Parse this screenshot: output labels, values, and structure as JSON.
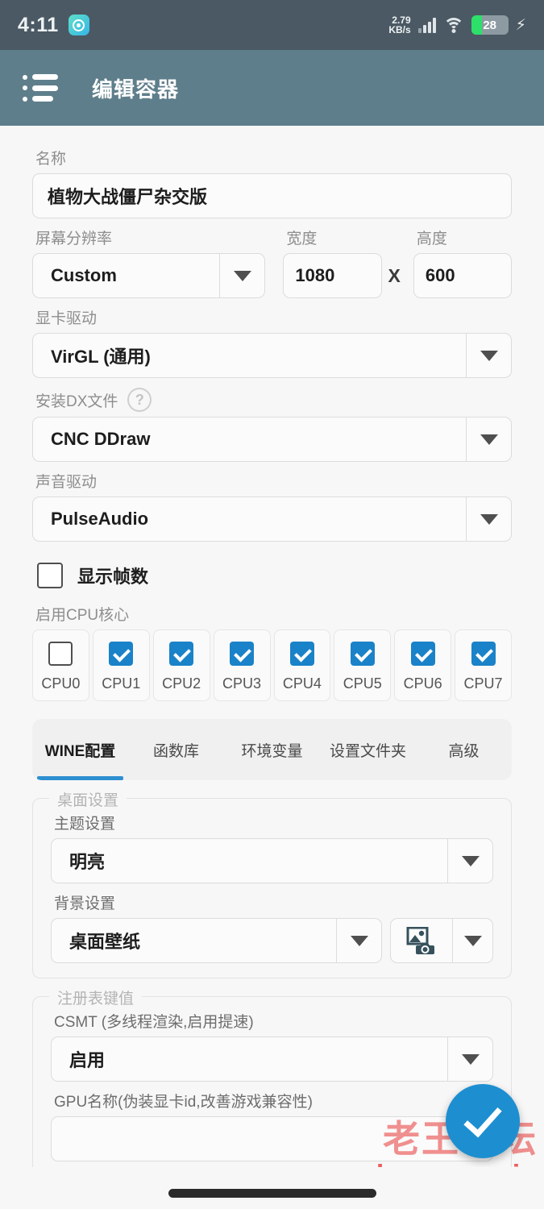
{
  "statusbar": {
    "clock": "4:11",
    "app_icon": "eye-app-icon",
    "network_speed_value": "2.79",
    "network_speed_unit": "KB/s",
    "signal_icon": "cellular-signal-icon",
    "wifi_icon": "wifi-icon",
    "battery_percent": "28",
    "battery_fill_color": "#2ce06a",
    "charging_icon": "charging-bolt-icon"
  },
  "appbar": {
    "menu_icon": "list-menu-icon",
    "title": "编辑容器",
    "background_color": "#5e7e8b"
  },
  "form": {
    "name_label": "名称",
    "name_value": "植物大战僵尸杂交版",
    "resolution_label": "屏幕分辨率",
    "resolution_value": "Custom",
    "width_label": "宽度",
    "width_value": "1080",
    "x_separator": "X",
    "height_label": "高度",
    "height_value": "600",
    "gpu_driver_label": "显卡驱动",
    "gpu_driver_value": "VirGL (通用)",
    "dx_label": "安装DX文件",
    "dx_help": "?",
    "dx_value": "CNC DDraw",
    "audio_label": "声音驱动",
    "audio_value": "PulseAudio",
    "show_fps_label": "显示帧数",
    "show_fps_checked": false,
    "cpu_section_label": "启用CPU核心",
    "cpu_cores": [
      {
        "name": "CPU0",
        "checked": false
      },
      {
        "name": "CPU1",
        "checked": true
      },
      {
        "name": "CPU2",
        "checked": true
      },
      {
        "name": "CPU3",
        "checked": true
      },
      {
        "name": "CPU4",
        "checked": true
      },
      {
        "name": "CPU5",
        "checked": true
      },
      {
        "name": "CPU6",
        "checked": true
      },
      {
        "name": "CPU7",
        "checked": true
      }
    ]
  },
  "tabs": [
    {
      "label": "WINE配置",
      "active": true
    },
    {
      "label": "函数库",
      "active": false
    },
    {
      "label": "环境变量",
      "active": false
    },
    {
      "label": "设置文件夹",
      "active": false
    },
    {
      "label": "高级",
      "active": false
    }
  ],
  "desktop_panel": {
    "legend": "桌面设置",
    "theme_label": "主题设置",
    "theme_value": "明亮",
    "background_label": "背景设置",
    "background_value": "桌面壁纸",
    "image_picker_icon": "image-camera-icon"
  },
  "registry_panel": {
    "legend": "注册表键值",
    "csmt_label": "CSMT (多线程渲染,启用提速)",
    "csmt_value": "启用",
    "gpu_name_label": "GPU名称(伪装显卡id,改善游戏兼容性)",
    "gpu_name_value": ""
  },
  "fab": {
    "icon": "check-icon",
    "color": "#1d8fd1"
  },
  "watermark": {
    "chinese": "老王论坛",
    "domain": "laowang.vip",
    "color": "#e83737"
  },
  "colors": {
    "accent": "#1a82c8",
    "tab_indicator": "#2d8fd0",
    "statusbar": "#4a5963",
    "appbar": "#5e7e8b",
    "page_background": "#f7f7f7"
  }
}
